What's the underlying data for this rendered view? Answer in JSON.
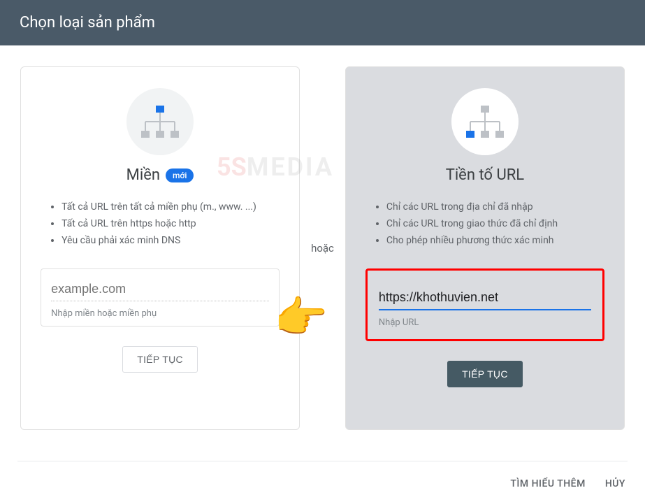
{
  "header": {
    "title": "Chọn loại sản phẩm"
  },
  "divider": "hoặc",
  "domain_card": {
    "title": "Miền",
    "badge": "mới",
    "bullets": [
      "Tất cả URL trên tất cả miền phụ (m., www. ...)",
      "Tất cả URL trên https hoặc http",
      "Yêu cầu phải xác minh DNS"
    ],
    "placeholder": "example.com",
    "helper": "Nhập miền hoặc miền phụ",
    "button": "TIẾP TỤC"
  },
  "url_card": {
    "title": "Tiền tố URL",
    "bullets": [
      "Chỉ các URL trong địa chỉ đã nhập",
      "Chỉ các URL trong giao thức đã chỉ định",
      "Cho phép nhiều phương thức xác minh"
    ],
    "value": "https://khothuvien.net",
    "helper": "Nhập URL",
    "button": "TIẾP TỤC"
  },
  "footer": {
    "learn_more": "TÌM HIỂU THÊM",
    "cancel": "HỦY"
  },
  "watermark": {
    "part1": "5S",
    "part2": "MEDIA"
  }
}
